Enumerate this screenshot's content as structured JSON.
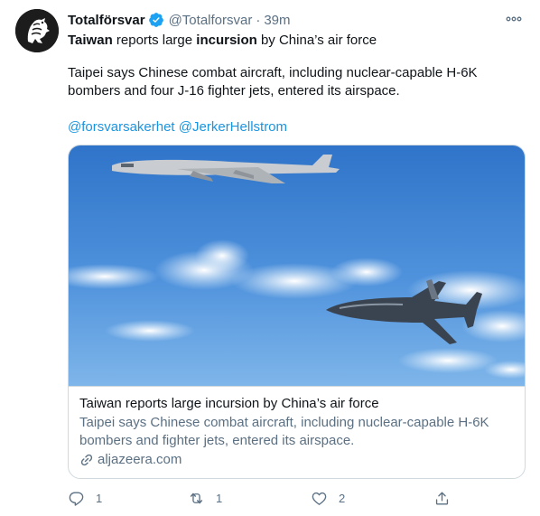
{
  "tweet": {
    "author_name": "Totalförsvar",
    "handle": "@Totalforsvar",
    "separator": "·",
    "time": "39m",
    "headline_part1": "Taiwan",
    "headline_part2": " reports large ",
    "headline_part3": "incursion",
    "headline_part4": " by China’s air force",
    "body": "Taipei says Chinese combat aircraft, including nuclear-capable H-6K bombers and four J-16 fighter jets, entered its airspace.",
    "mention1": "@forsvarsakerhet",
    "mention2": "@JerkerHellstrom"
  },
  "card": {
    "title": "Taiwan reports large incursion by China’s air force",
    "description": "Taipei says Chinese combat aircraft, including nuclear-capable H-6K bombers and fighter jets, entered its airspace.",
    "domain": "aljazeera.com"
  },
  "actions": {
    "reply_count": "1",
    "retweet_count": "1",
    "like_count": "2"
  },
  "colors": {
    "link": "#1b95e0",
    "secondary": "#5b7083",
    "verified": "#1da1f2"
  },
  "icons": {
    "verified": "verified-badge-icon",
    "more": "more-options-icon",
    "reply": "reply-icon",
    "retweet": "retweet-icon",
    "like": "heart-icon",
    "share": "share-icon",
    "link": "link-icon"
  }
}
